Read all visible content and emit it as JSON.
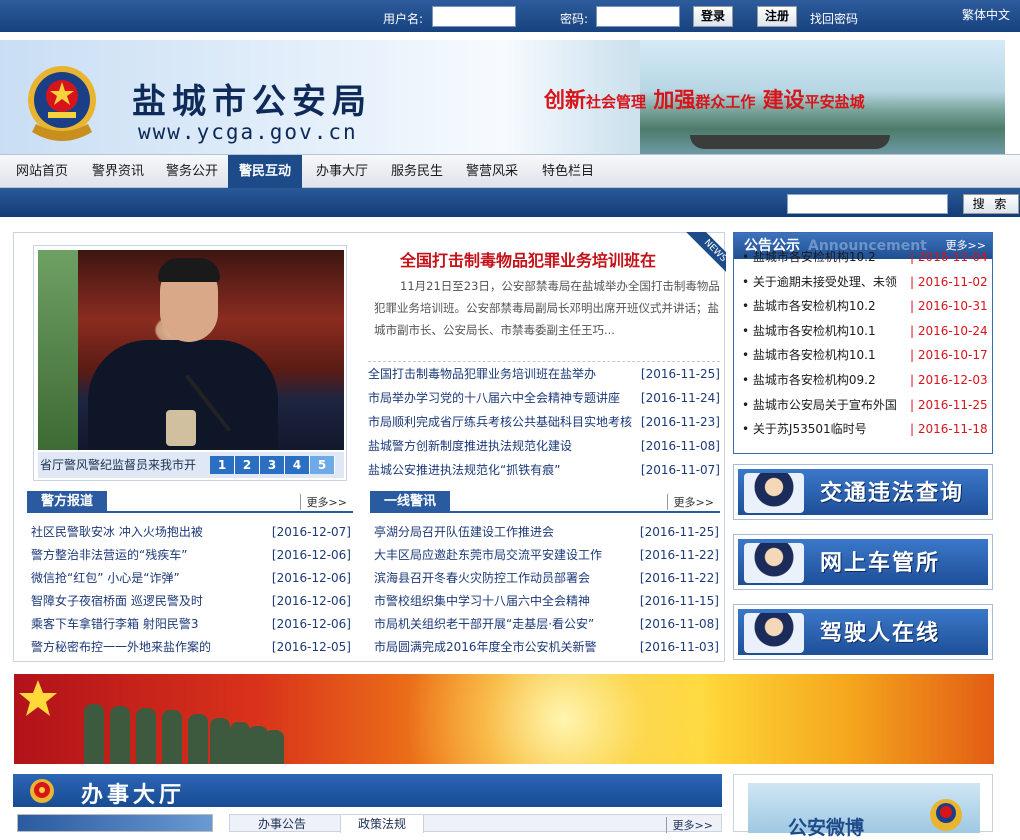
{
  "topbar": {
    "username_label": "用户名:",
    "password_label": "密码:",
    "login_label": "登录",
    "register_label": "注册",
    "forgot_label": "找回密码",
    "lang_label": "繁体中文"
  },
  "banner": {
    "title": "盐城市公安局",
    "url": "www.ycga.gov.cn",
    "slogan_parts": [
      "创新",
      "社会管理",
      " 加强",
      "群众工作",
      " 建设",
      "平安盐城"
    ]
  },
  "nav": {
    "items": [
      "网站首页",
      "警界资讯",
      "警务公开",
      "警民互动",
      "办事大厅",
      "服务民生",
      "警营风采",
      "特色栏目"
    ],
    "active_index": 3
  },
  "search": {
    "button_label": "搜 索"
  },
  "slider": {
    "caption": "省厅警风警纪监督员来我市开",
    "pages": [
      "1",
      "2",
      "3",
      "4",
      "5"
    ],
    "current_page": 5
  },
  "headline": {
    "title": "全国打击制毒物品犯罪业务培训班在",
    "ribbon": "NEWS",
    "summary": "11月21日至23日，公安部禁毒局在盐城举办全国打击制毒物品犯罪业务培训班。公安部禁毒局副局长邓明出席开班仪式并讲话；盐城市副市长、公安局长、市禁毒委副主任王巧..."
  },
  "top_news": [
    {
      "title": "全国打击制毒物品犯罪业务培训班在盐举办",
      "date": "[2016-11-25]"
    },
    {
      "title": "市局举办学习党的十八届六中全会精神专题讲座",
      "date": "[2016-11-24]"
    },
    {
      "title": "市局顺利完成省厅练兵考核公共基础科目实地考核",
      "date": "[2016-11-23]"
    },
    {
      "title": "盐城警方创新制度推进执法规范化建设",
      "date": "[2016-11-08]"
    },
    {
      "title": "盐城公安推进执法规范化“抓铁有痕”",
      "date": "[2016-11-07]"
    }
  ],
  "police_report": {
    "title": "警方报道",
    "more": "更多>>",
    "items": [
      {
        "title": "社区民警耿安冰 冲入火场抱出被",
        "date": "[2016-12-07]"
      },
      {
        "title": "警方整治非法营运的“残疾车”",
        "date": "[2016-12-06]"
      },
      {
        "title": "微信抢“红包” 小心是“诈弹”",
        "date": "[2016-12-06]"
      },
      {
        "title": "智障女子夜宿桥面 巡逻民警及时",
        "date": "[2016-12-06]"
      },
      {
        "title": "乘客下车拿错行李箱 射阳民警3",
        "date": "[2016-12-06]"
      },
      {
        "title": "警方秘密布控一一外地来盐作案的",
        "date": "[2016-12-05]"
      }
    ]
  },
  "frontline": {
    "title": "一线警讯",
    "more": "更多>>",
    "items": [
      {
        "title": "亭湖分局召开队伍建设工作推进会",
        "date": "[2016-11-25]"
      },
      {
        "title": "大丰区局应邀赴东莞市局交流平安建设工作",
        "date": "[2016-11-22]"
      },
      {
        "title": "滨海县召开冬春火灾防控工作动员部署会",
        "date": "[2016-11-22]"
      },
      {
        "title": "市警校组织集中学习十八届六中全会精神",
        "date": "[2016-11-15]"
      },
      {
        "title": "市局机关组织老干部开展“走基层·看公安”",
        "date": "[2016-11-08]"
      },
      {
        "title": "市局圆满完成2016年度全市公安机关新警",
        "date": "[2016-11-03]"
      }
    ]
  },
  "notice": {
    "title": "公告公示",
    "title_en": "Announcement",
    "more": "更多>>",
    "items": [
      {
        "title": "盐城市各安检机构10.2",
        "date": "| 2016-11-04"
      },
      {
        "title": "关于逾期未接受处理、未领",
        "date": "| 2016-11-02"
      },
      {
        "title": "盐城市各安检机构10.2",
        "date": "| 2016-10-31"
      },
      {
        "title": "盐城市各安检机构10.1",
        "date": "| 2016-10-24"
      },
      {
        "title": "盐城市各安检机构10.1",
        "date": "| 2016-10-17"
      },
      {
        "title": "盐城市各安检机构09.2",
        "date": "| 2016-12-03"
      },
      {
        "title": "盐城市公安局关于宣布外国",
        "date": "| 2016-11-25"
      },
      {
        "title": "关于苏J53501临时号",
        "date": "| 2016-11-18"
      }
    ]
  },
  "services": [
    {
      "label": "交通违法查询",
      "icon": "traffic-police-icon"
    },
    {
      "label": "网上车管所",
      "icon": "vehicle-office-icon"
    },
    {
      "label": "驾驶人在线",
      "icon": "driver-icon"
    }
  ],
  "hall": {
    "title": "办事大厅",
    "tabs": [
      "办事公告",
      "政策法规"
    ],
    "more": "更多>>"
  },
  "weibo": {
    "label": "公安微博"
  },
  "colors": {
    "primary": "#1d4b8a",
    "accent_red": "#d8141b",
    "link": "#1c3a78"
  }
}
